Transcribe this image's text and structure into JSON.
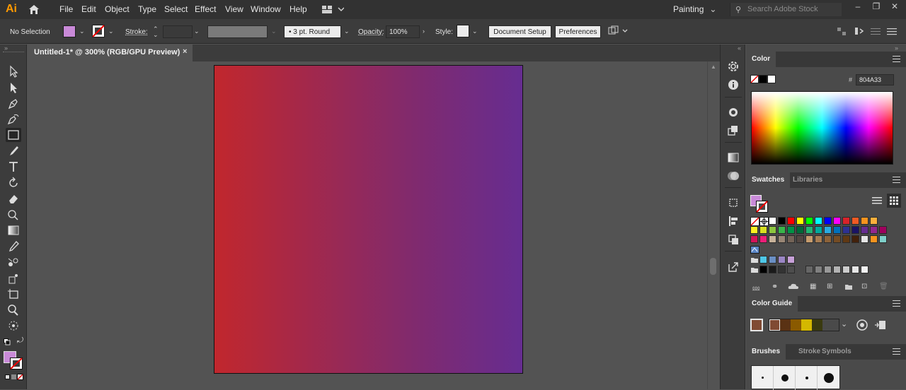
{
  "app": {
    "logo": "Ai",
    "menu": [
      "File",
      "Edit",
      "Object",
      "Type",
      "Select",
      "Effect",
      "View",
      "Window",
      "Help"
    ],
    "workspace": "Painting",
    "search_placeholder": "Search Adobe Stock"
  },
  "control_bar": {
    "selection": "No Selection",
    "stroke_label": "Stroke:",
    "brush_value": "3 pt. Round",
    "opacity_label": "Opacity:",
    "opacity_value": "100%",
    "style_label": "Style:",
    "document_setup": "Document Setup",
    "preferences": "Preferences"
  },
  "document": {
    "tab_title": "Untitled-1* @ 300% (RGB/GPU Preview)",
    "close": "×",
    "artboard_gradient": [
      "#c1272d",
      "#802a6e",
      "#662d91"
    ]
  },
  "toolbar": {
    "tools": [
      "selection-tool",
      "direct-selection-tool",
      "pen-tool",
      "curvature-tool",
      "rectangle-tool",
      "paintbrush-tool",
      "type-tool",
      "rotate-tool",
      "eraser-tool",
      "shape-builder-tool",
      "gradient-tool",
      "eyedropper-tool",
      "blend-tool",
      "symbol-sprayer-tool",
      "artboard-tool",
      "zoom-tool",
      "perspective-tool"
    ],
    "fill_color": "#c98ad8",
    "stroke_color": "none"
  },
  "panels": {
    "color": {
      "title": "Color",
      "hex_symbol": "#",
      "hex": "804A33"
    },
    "swatches": {
      "tabs": [
        "Swatches",
        "Libraries"
      ],
      "rows": [
        [
          "#ffffff",
          "#000000",
          "#ff0000",
          "#ffff00",
          "#00ff00",
          "#00ffff",
          "#0000ff",
          "#ff00ff",
          "#d8232a",
          "#f15a24",
          "#f7931e",
          "#fbb03b"
        ],
        [
          "#fcee21",
          "#d9e021",
          "#8cc63f",
          "#39b54a",
          "#009245",
          "#006837",
          "#22b573",
          "#00a99d",
          "#29abe2",
          "#0071bc",
          "#2e3192",
          "#1b1464",
          "#662d91",
          "#93278f",
          "#9e005d"
        ],
        [
          "#d4145a",
          "#ed1e79",
          "#c7b299",
          "#998675",
          "#736357",
          "#534741",
          "#c69c6d",
          "#a67c52",
          "#8c6239",
          "#754c24",
          "#603813",
          "#42210b",
          "#e6e6e6",
          "#f7931e",
          "#7fcfc9"
        ]
      ],
      "group1": [
        "#4ec7e7",
        "#6a8fc4",
        "#9b86c5",
        "#c7a0d8"
      ],
      "grays": [
        "#000000",
        "#1a1a1a",
        "#333333",
        "#4d4d4d",
        "#666666",
        "#808080",
        "#999999",
        "#b3b3b3",
        "#cccccc",
        "#e6e6e6",
        "#f2f2f2"
      ]
    },
    "color_guide": {
      "title": "Color Guide",
      "base": "#804a33",
      "harmony": [
        "#804a33",
        "#5a3214",
        "#8a5a00",
        "#d4b800",
        "#3a3a10"
      ]
    },
    "brushes": {
      "tabs": [
        "Brushes",
        "Stroke",
        "Symbols"
      ]
    }
  }
}
